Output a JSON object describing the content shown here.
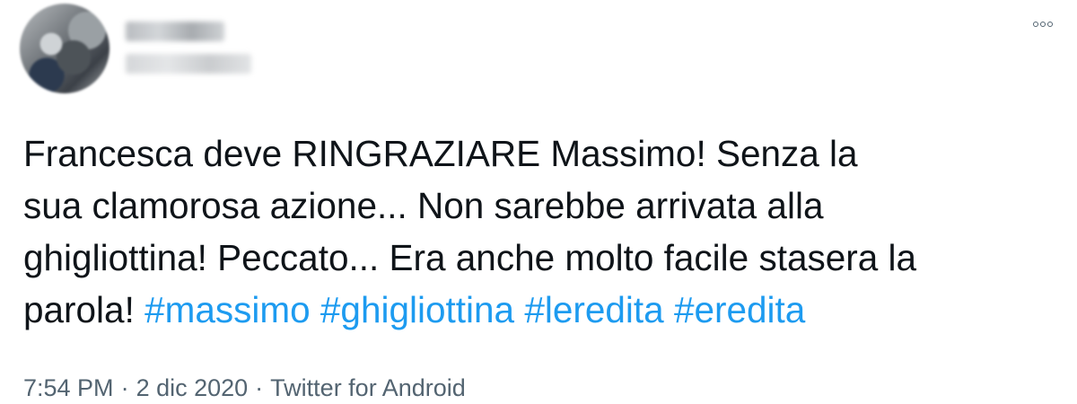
{
  "tweet": {
    "more_icon": "more-horizontal-icon",
    "text_lines": [
      "Francesca deve RINGRAZIARE Massimo! Senza la",
      "sua clamorosa azione... Non sarebbe arrivata alla",
      "ghigliottina! Peccato... Era anche molto facile stasera la",
      "parola! "
    ],
    "hashtags": [
      "#massimo",
      "#ghigliottina",
      "#leredita",
      "#eredita"
    ],
    "time": "7:54 PM",
    "date": "2 dic 2020",
    "source": "Twitter for Android",
    "separator": "·"
  },
  "colors": {
    "text": "#0f1419",
    "secondary": "#536471",
    "link": "#1d9bf0"
  }
}
